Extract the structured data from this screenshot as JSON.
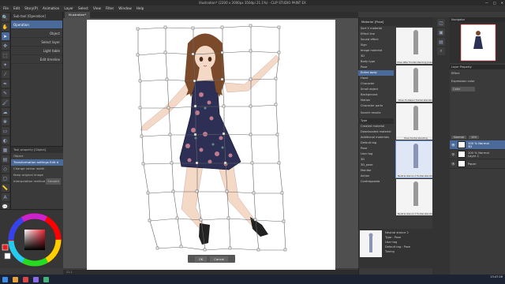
{
  "title_bar": {
    "text": "Illustration* (2200 x 2000px 350dpi 21.1%)  - CLIP STUDIO PAINT EX"
  },
  "menu": [
    "File",
    "Edit",
    "Story(P)",
    "Animation",
    "Layer",
    "Select",
    "View",
    "Filter",
    "Window",
    "Help"
  ],
  "document_tab": "Illustration*",
  "subtool_panel": {
    "items": [
      {
        "label": "Sub tool [Operation]"
      },
      {
        "label": "Operation",
        "selected": true
      },
      {
        "label": "Object"
      },
      {
        "label": "Select layer"
      },
      {
        "label": "Light table"
      },
      {
        "label": "Edit timeline"
      }
    ]
  },
  "tool_property": {
    "items": [
      {
        "label": "Tool property [Object]"
      },
      {
        "label": "Object",
        "highlight": false
      },
      {
        "label": "Transformation settings Edit d",
        "highlight": true
      },
      {
        "label": "Change vector width"
      },
      {
        "label": "Keep original image"
      },
      {
        "label": "Interpolation method",
        "value": "Smooth"
      }
    ]
  },
  "dialog": {
    "ok_label": "OK",
    "cancel_label": "Cancel"
  },
  "status_bar": {
    "text": "21.1"
  },
  "material_panel": {
    "title": "Material [Pose]",
    "tree": [
      {
        "label": "Sort V material"
      },
      {
        "label": "Effect line"
      },
      {
        "label": "Sound effect"
      },
      {
        "label": "Sign"
      },
      {
        "label": "Image material"
      },
      {
        "label": "3D"
      },
      {
        "label": "Body type"
      },
      {
        "label": "Pose"
      },
      {
        "label": "Entire body",
        "selected": true
      },
      {
        "label": "Hand"
      },
      {
        "label": "Character"
      },
      {
        "label": "Small object"
      },
      {
        "label": "Background"
      },
      {
        "label": "Motion"
      },
      {
        "label": "Character parts"
      },
      {
        "label": "Search results"
      }
    ],
    "filters": [
      "Type",
      "Created material",
      "Downloaded material",
      "Additional materials",
      "Default tag",
      "Pose",
      "User tag",
      "3D",
      "3D_pose",
      "Monitor",
      "Action",
      "Contrapposto"
    ],
    "thumbs": [
      {
        "caption": "Pose after frontal standing pose 1"
      },
      {
        "caption": "Pose (3-shape) frontal standing"
      },
      {
        "caption": "Pose frontal standing"
      },
      {
        "caption": "Neutral stance 2 frontal standing",
        "selected": true
      },
      {
        "caption": "Neutral stance 3 frontal standing"
      },
      {
        "caption": "Neutral stance 4 frontal standing"
      },
      {
        "caption": "Looking over shoulder frontal standing"
      }
    ],
    "info": {
      "name": "Neutral stance 2",
      "type": "Type : Pose",
      "user_tag": "User tag",
      "default_tag": "Default tag : Pose",
      "tuning": "Tuning"
    }
  },
  "navigator": {
    "title": "Navigator"
  },
  "layer_property": {
    "title": "Layer Property",
    "effect": "Effect",
    "expression_color": "Expression color",
    "color_value": "Color"
  },
  "layers": {
    "blend_mode": "Normal",
    "opacity": "100",
    "items": [
      {
        "name": "100 % Normal",
        "sub": "3D",
        "selected": true
      },
      {
        "name": "100 % Normal",
        "sub": "Layer 1"
      },
      {
        "name": "Paper"
      }
    ]
  },
  "taskbar": {
    "time": "13:47:26",
    "date": ""
  },
  "colors": {
    "accent": "#4a6a9a",
    "paper": "#ffffff",
    "dress": "#2d2f55",
    "hair": "#7a4a2a",
    "skin": "#f4d9c6"
  }
}
